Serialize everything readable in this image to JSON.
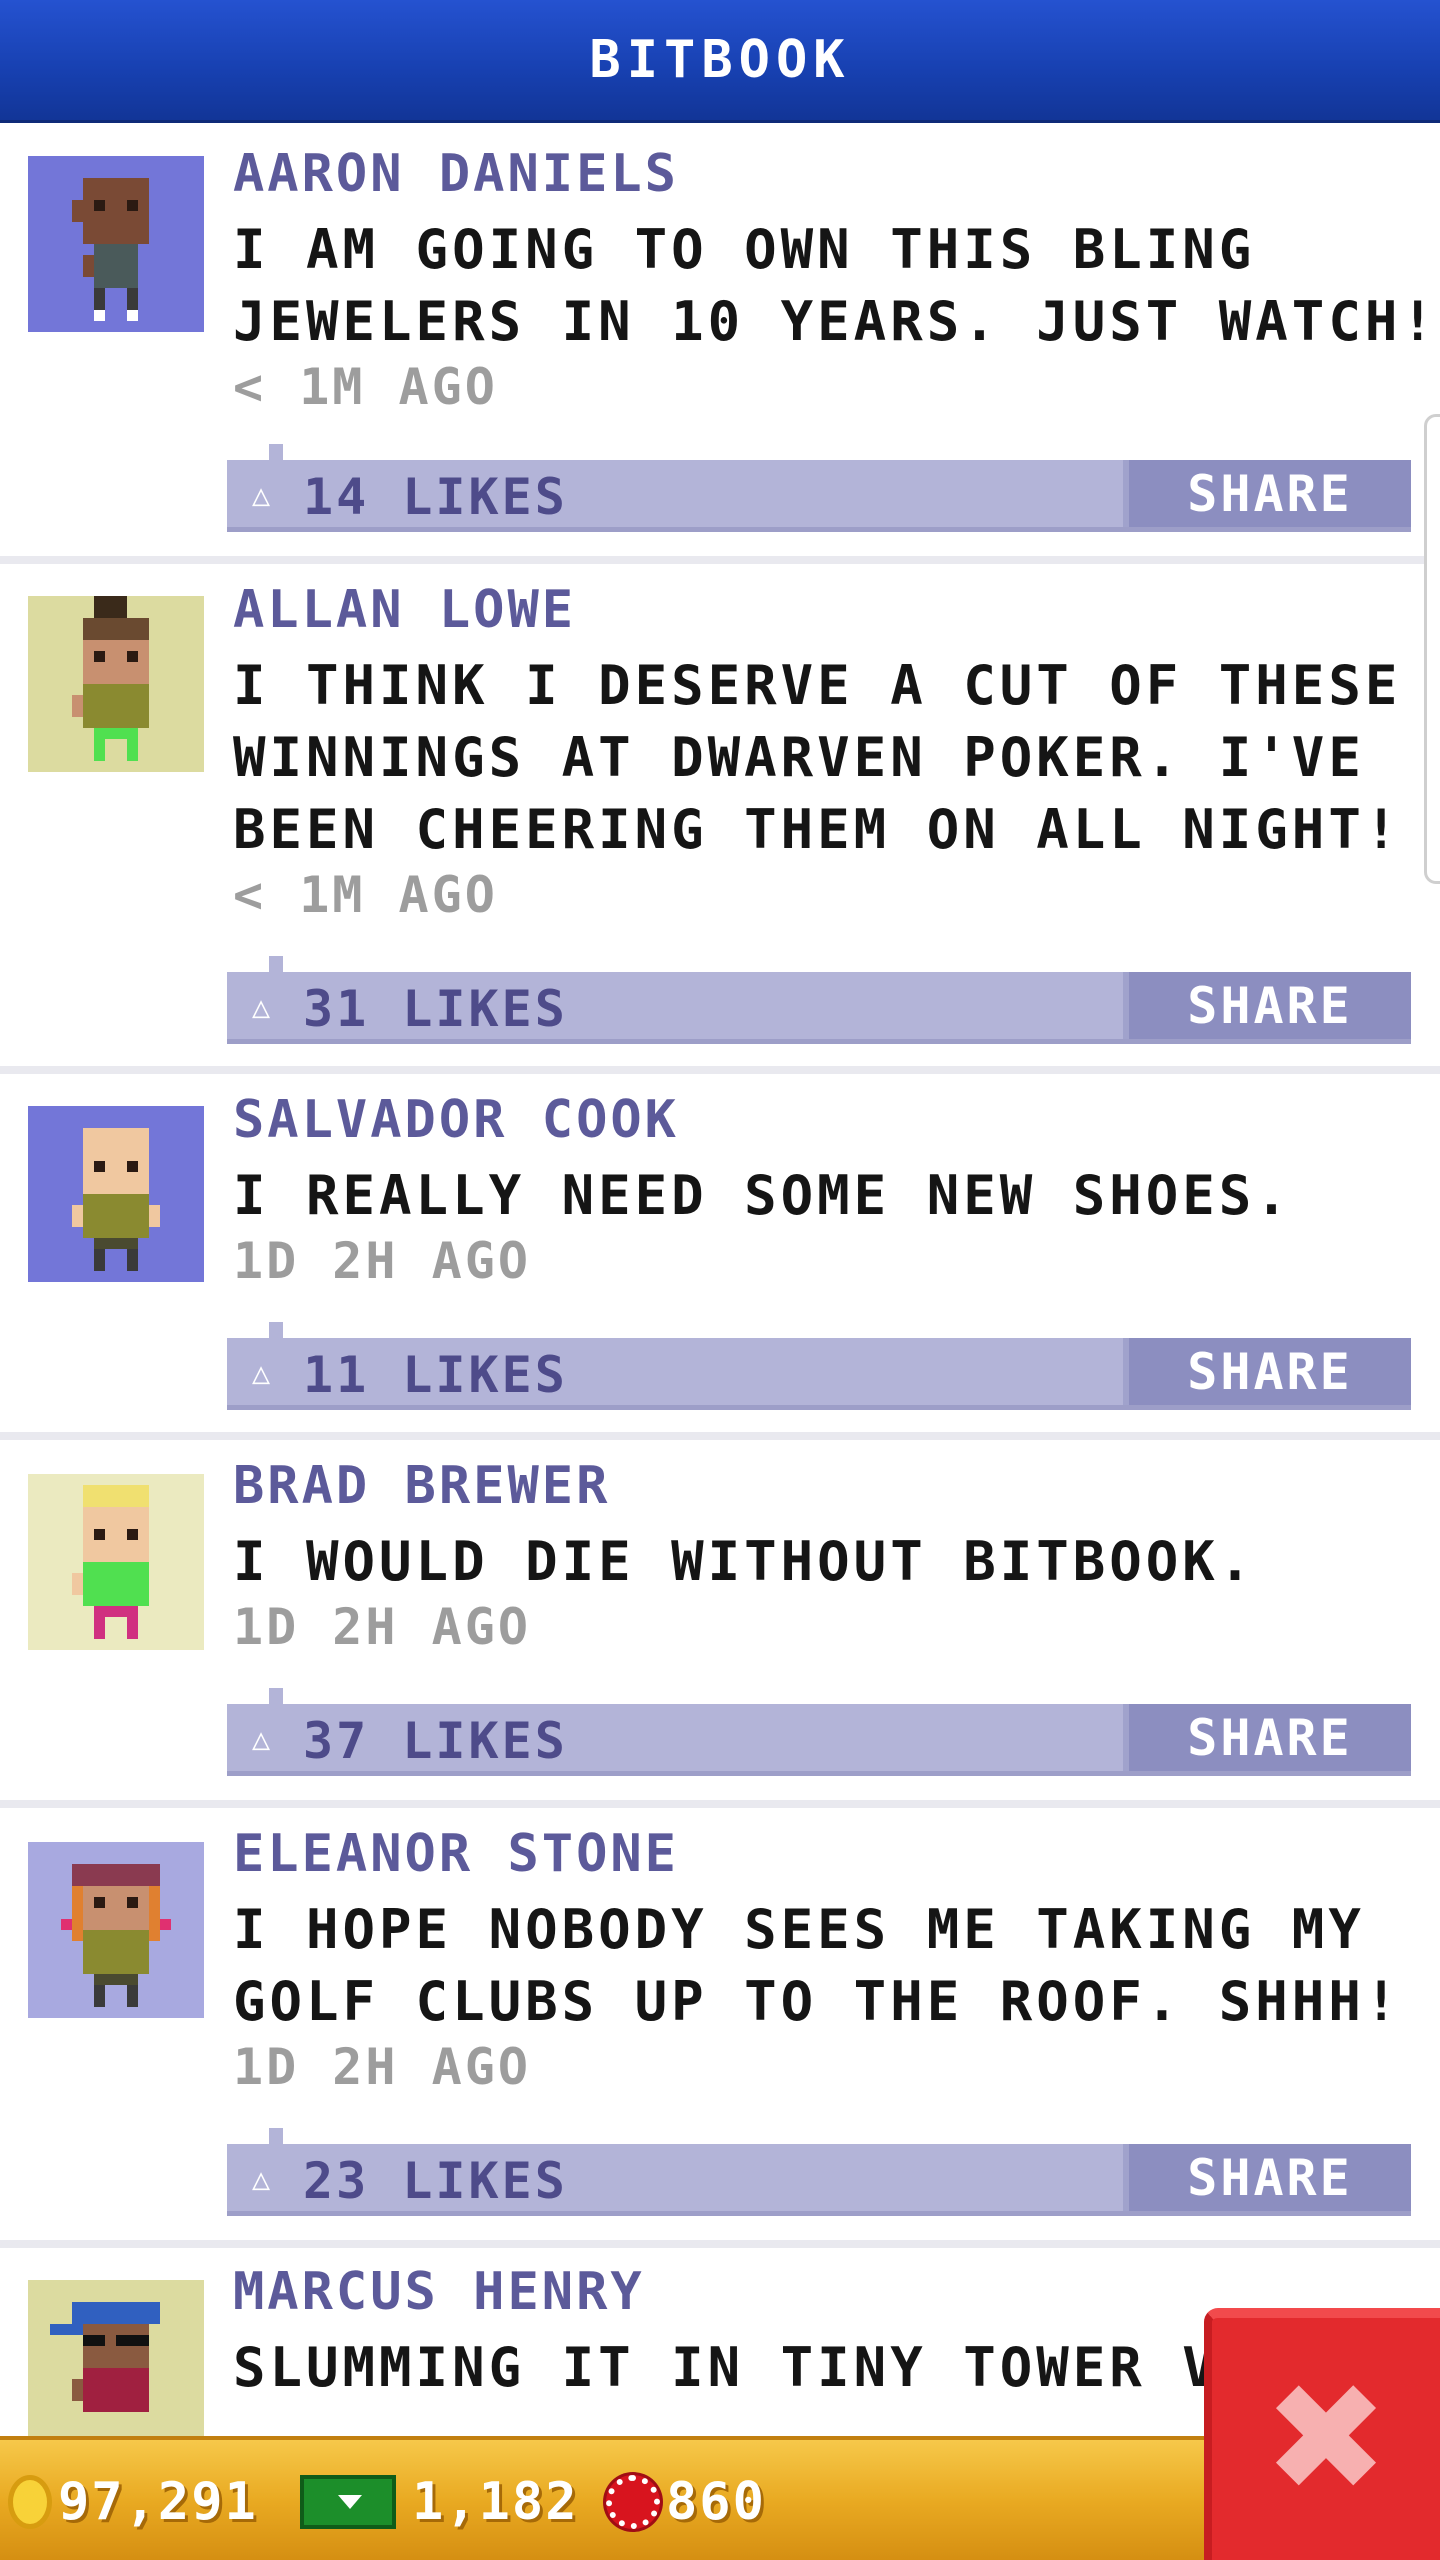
{
  "app": {
    "title": "BITBOOK"
  },
  "posts": [
    {
      "author": "AARON DANIELS",
      "lines": [
        "I AM GOING TO OWN THIS BLING",
        "JEWELERS IN 10 YEARS. JUST WATCH!"
      ],
      "time": "< 1M AGO",
      "likes": "14 LIKES",
      "share": "SHARE",
      "avatar": "dark-skin-man-avatar"
    },
    {
      "author": "ALLAN LOWE",
      "lines": [
        "I THINK I DESERVE A CUT OF THESE",
        "WINNINGS AT DWARVEN POKER. I'VE",
        "BEEN CHEERING THEM ON ALL NIGHT!"
      ],
      "time": "< 1M AGO",
      "likes": "31 LIKES",
      "share": "SHARE",
      "avatar": "man-bun-avatar"
    },
    {
      "author": "SALVADOR COOK",
      "lines": [
        "I REALLY NEED SOME NEW SHOES."
      ],
      "time": "1D 2H AGO",
      "likes": "11 LIKES",
      "share": "SHARE",
      "avatar": "bald-man-avatar"
    },
    {
      "author": "BRAD BREWER",
      "lines": [
        "I WOULD DIE WITHOUT BITBOOK."
      ],
      "time": "1D 2H AGO",
      "likes": "37 LIKES",
      "share": "SHARE",
      "avatar": "blonde-man-avatar"
    },
    {
      "author": "ELEANOR STONE",
      "lines": [
        "I HOPE NOBODY SEES ME TAKING MY",
        "GOLF CLUBS UP TO THE ROOF. SHHH!"
      ],
      "time": "1D 2H AGO",
      "likes": "23 LIKES",
      "share": "SHARE",
      "avatar": "redhead-woman-avatar"
    },
    {
      "author": "MARCUS HENRY",
      "lines": [
        "SLUMMING IT IN TINY TOWER VE"
      ],
      "time": "",
      "likes": "",
      "share": "",
      "avatar": "cap-sunglasses-man-avatar"
    }
  ],
  "resources": {
    "coins": "97,291",
    "bux": "1,182",
    "chips": "860"
  },
  "close": {
    "icon": "close-icon"
  },
  "colors": {
    "header": "#1740b0",
    "author": "#5c5a9a",
    "likebar": "#b3b4d8",
    "share": "#8c8ec0",
    "bottom_bar": "#e9aa22",
    "close": "#e32a2d"
  }
}
